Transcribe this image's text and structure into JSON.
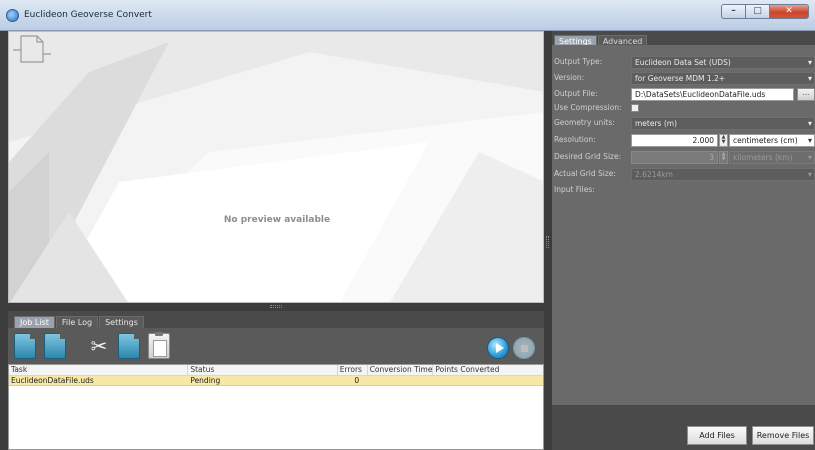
{
  "window": {
    "title": "Euclideon Geoverse Convert"
  },
  "preview": {
    "message": "No preview available"
  },
  "bottom_tabs": [
    "Job List",
    "File Log",
    "Settings"
  ],
  "job_table": {
    "columns": [
      "Task",
      "Status",
      "Errors",
      "Conversion Time",
      "Points Converted"
    ],
    "rows": [
      {
        "task": "EuclideonDataFile.uds",
        "status": "Pending",
        "errors": "0",
        "time": "",
        "points": ""
      }
    ]
  },
  "right_tabs": [
    "Settings",
    "Advanced"
  ],
  "settings": {
    "output_type": {
      "label": "Output Type:",
      "value": "Euclideon Data Set (UDS)"
    },
    "version": {
      "label": "Version:",
      "value": "for Geoverse MDM 1.2+"
    },
    "output_file": {
      "label": "Output File:",
      "value": "D:\\DataSets\\EuclideonDataFile.uds",
      "browse": "..."
    },
    "use_compression": {
      "label": "Use Compression:"
    },
    "geometry_units": {
      "label": "Geometry units:",
      "value": "meters (m)"
    },
    "resolution": {
      "label": "Resolution:",
      "value": "2.000",
      "unit": "centimeters (cm)"
    },
    "desired_grid": {
      "label": "Desired Grid Size:",
      "value": "3",
      "unit": "kilometers (km)"
    },
    "actual_grid": {
      "label": "Actual Grid Size:",
      "value": "2.6214km"
    },
    "input_files": {
      "label": "Input Files:"
    }
  },
  "buttons": {
    "add_files": "Add Files",
    "remove_files": "Remove Files"
  }
}
